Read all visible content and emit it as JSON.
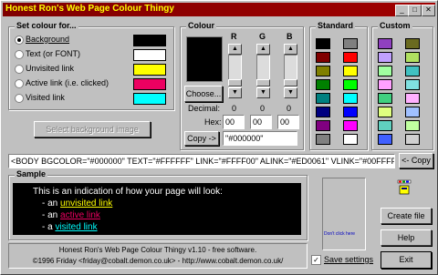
{
  "window": {
    "title": "Honest Ron's Web Page Colour Thingy"
  },
  "set_colour": {
    "title": "Set colour for...",
    "options": [
      {
        "label": "Background",
        "color": "#000000",
        "selected": true
      },
      {
        "label": "Text (or FONT)",
        "color": "#FFFFFF",
        "selected": false
      },
      {
        "label": "Unvisited link",
        "color": "#FFFF00",
        "selected": false
      },
      {
        "label": "Active link (i.e. clicked)",
        "color": "#ED0061",
        "selected": false
      },
      {
        "label": "Visited link",
        "color": "#00FFFF",
        "selected": false
      }
    ],
    "select_bg_image": "Select background image"
  },
  "colour": {
    "title": "Colour",
    "current": "#000000",
    "choose": "Choose...",
    "r": "R",
    "g": "G",
    "b": "B",
    "decimal_label": "Decimal:",
    "decimal": [
      "0",
      "0",
      "0"
    ],
    "hex_label": "Hex:",
    "hex": [
      "00",
      "00",
      "00"
    ],
    "copy": "Copy ->",
    "hex_value": "\"#000000\""
  },
  "standard": {
    "title": "Standard",
    "colors": [
      "#000000",
      "#808080",
      "#800000",
      "#FF0000",
      "#808000",
      "#FFFF00",
      "#008000",
      "#00FF00",
      "#008080",
      "#00FFFF",
      "#000080",
      "#0000FF",
      "#800080",
      "#FF00FF",
      "#808080",
      "#FFFFFF"
    ]
  },
  "custom": {
    "title": "Custom",
    "colors": [
      "#9040c0",
      "#6a6a20",
      "#c0a0ff",
      "#b0e060",
      "#a0ffa0",
      "#40c0c0",
      "#ffa0ff",
      "#80e0e0",
      "#40d080",
      "#ffb0ff",
      "#e0ff80",
      "#a0c0ff",
      "#60d0c0",
      "#c0ffa0",
      "#4060ff",
      "#d0d0d0"
    ]
  },
  "body_tag": "<BODY BGCOLOR=\"#000000\" TEXT=\"#FFFFFF\" LINK=\"#FFFF00\" ALINK=\"#ED0061\" VLINK=\"#00FFFF\">",
  "copy_tag": "<- Copy",
  "sample": {
    "title": "Sample",
    "intro": "This is an indication of how your page will look:",
    "prefix1": "- an ",
    "link1": "unvisited link",
    "prefix2": "- an ",
    "link2": "active link",
    "prefix3": "- a ",
    "link3": "visited link"
  },
  "dont_click": "Don't click here",
  "buttons": {
    "create_file": "Create file",
    "help": "Help",
    "exit": "Exit"
  },
  "save_settings": "Save settings",
  "footer": {
    "line1": "Honest Ron's Web Page Colour Thingy v1.10 - free software.",
    "line2": "©1996 Friday <friday@cobalt.demon.co.uk> - http://www.cobalt.demon.co.uk/"
  }
}
